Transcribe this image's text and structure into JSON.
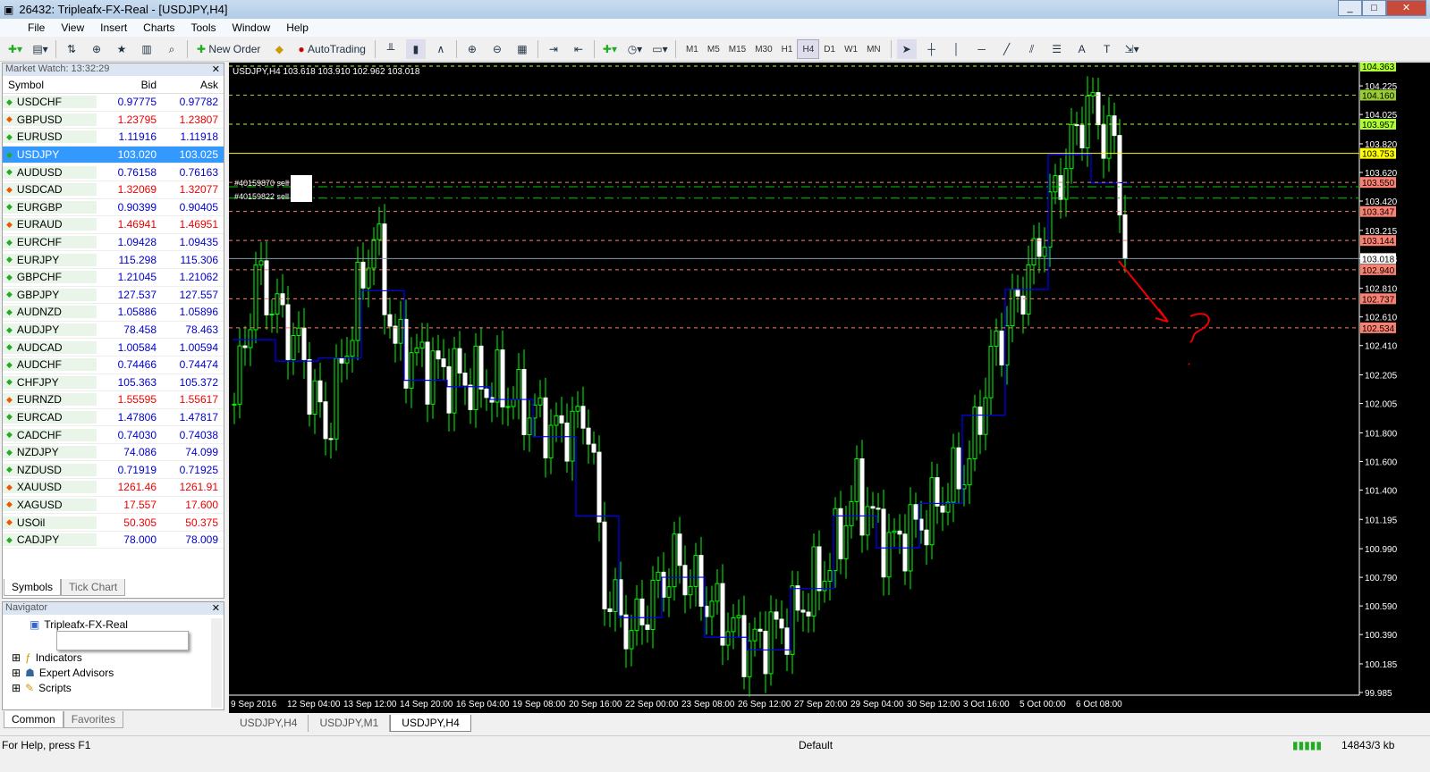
{
  "window": {
    "title": "26432: Tripleafx-FX-Real - [USDJPY,H4]"
  },
  "menu": [
    "File",
    "View",
    "Insert",
    "Charts",
    "Tools",
    "Window",
    "Help"
  ],
  "toolbar": {
    "new_order": "New Order",
    "autotrading": "AutoTrading",
    "timeframes": [
      "M1",
      "M5",
      "M15",
      "M30",
      "H1",
      "H4",
      "D1",
      "W1",
      "MN"
    ],
    "active_tf": "H4"
  },
  "market_watch": {
    "title": "Market Watch: 13:32:29",
    "headers": [
      "Symbol",
      "Bid",
      "Ask"
    ],
    "rows": [
      {
        "s": "USDCHF",
        "bid": "0.97775",
        "ask": "0.97782",
        "dir": "up"
      },
      {
        "s": "GBPUSD",
        "bid": "1.23795",
        "ask": "1.23807",
        "dir": "down"
      },
      {
        "s": "EURUSD",
        "bid": "1.11916",
        "ask": "1.11918",
        "dir": "up"
      },
      {
        "s": "USDJPY",
        "bid": "103.020",
        "ask": "103.025",
        "dir": "up",
        "selected": true
      },
      {
        "s": "AUDUSD",
        "bid": "0.76158",
        "ask": "0.76163",
        "dir": "up"
      },
      {
        "s": "USDCAD",
        "bid": "1.32069",
        "ask": "1.32077",
        "dir": "down"
      },
      {
        "s": "EURGBP",
        "bid": "0.90399",
        "ask": "0.90405",
        "dir": "up"
      },
      {
        "s": "EURAUD",
        "bid": "1.46941",
        "ask": "1.46951",
        "dir": "down"
      },
      {
        "s": "EURCHF",
        "bid": "1.09428",
        "ask": "1.09435",
        "dir": "up"
      },
      {
        "s": "EURJPY",
        "bid": "115.298",
        "ask": "115.306",
        "dir": "up"
      },
      {
        "s": "GBPCHF",
        "bid": "1.21045",
        "ask": "1.21062",
        "dir": "up"
      },
      {
        "s": "GBPJPY",
        "bid": "127.537",
        "ask": "127.557",
        "dir": "up"
      },
      {
        "s": "AUDNZD",
        "bid": "1.05886",
        "ask": "1.05896",
        "dir": "up"
      },
      {
        "s": "AUDJPY",
        "bid": "78.458",
        "ask": "78.463",
        "dir": "up"
      },
      {
        "s": "AUDCAD",
        "bid": "1.00584",
        "ask": "1.00594",
        "dir": "up"
      },
      {
        "s": "AUDCHF",
        "bid": "0.74466",
        "ask": "0.74474",
        "dir": "up"
      },
      {
        "s": "CHFJPY",
        "bid": "105.363",
        "ask": "105.372",
        "dir": "up"
      },
      {
        "s": "EURNZD",
        "bid": "1.55595",
        "ask": "1.55617",
        "dir": "down"
      },
      {
        "s": "EURCAD",
        "bid": "1.47806",
        "ask": "1.47817",
        "dir": "up"
      },
      {
        "s": "CADCHF",
        "bid": "0.74030",
        "ask": "0.74038",
        "dir": "up"
      },
      {
        "s": "NZDJPY",
        "bid": "74.086",
        "ask": "74.099",
        "dir": "up"
      },
      {
        "s": "NZDUSD",
        "bid": "0.71919",
        "ask": "0.71925",
        "dir": "up"
      },
      {
        "s": "XAUUSD",
        "bid": "1261.46",
        "ask": "1261.91",
        "dir": "down"
      },
      {
        "s": "XAGUSD",
        "bid": "17.557",
        "ask": "17.600",
        "dir": "down"
      },
      {
        "s": "USOil",
        "bid": "50.305",
        "ask": "50.375",
        "dir": "down"
      },
      {
        "s": "CADJPY",
        "bid": "78.000",
        "ask": "78.009",
        "dir": "up"
      }
    ],
    "tabs": [
      "Symbols",
      "Tick Chart"
    ]
  },
  "navigator": {
    "title": "Navigator",
    "account": "Tripleafx-FX-Real",
    "items": [
      "Indicators",
      "Expert Advisors",
      "Scripts"
    ],
    "tabs": [
      "Common",
      "Favorites"
    ]
  },
  "chart": {
    "header": "USDJPY,H4  103.618 103.910 102.962 103.018",
    "orders": [
      "#40159870 sell",
      "#40159822 sell"
    ],
    "ymin": 99.985,
    "ymax": 104.363,
    "price_ticks": [
      "104.225",
      "104.025",
      "103.820",
      "103.620",
      "103.420",
      "103.215",
      "103.018",
      "102.810",
      "102.610",
      "102.410",
      "102.205",
      "102.005",
      "101.800",
      "101.600",
      "101.400",
      "101.195",
      "100.990",
      "100.790",
      "100.590",
      "100.390",
      "100.185",
      "99.985"
    ],
    "levels": [
      {
        "p": "104.363",
        "c": "#adff2f",
        "style": "dash"
      },
      {
        "p": "104.160",
        "c": "#9acd32",
        "style": "dash"
      },
      {
        "p": "103.957",
        "c": "#adff2f",
        "style": "dash"
      },
      {
        "p": "103.753",
        "c": "#ffff00",
        "style": "solid"
      },
      {
        "p": "103.550",
        "c": "#fa8072",
        "style": "dash"
      },
      {
        "p": "103.347",
        "c": "#fa8072",
        "style": "dash"
      },
      {
        "p": "103.144",
        "c": "#fa8072",
        "style": "dash"
      },
      {
        "p": "103.018",
        "c": "#ffffff",
        "style": "bid"
      },
      {
        "p": "102.940",
        "c": "#fa8072",
        "style": "dash"
      },
      {
        "p": "102.737",
        "c": "#fa8072",
        "style": "dash"
      },
      {
        "p": "102.534",
        "c": "#fa8072",
        "style": "dash"
      }
    ],
    "path": [
      [
        0,
        102.0
      ],
      [
        4,
        102.9
      ],
      [
        12,
        102.4
      ],
      [
        17,
        101.8
      ],
      [
        26,
        103.2
      ],
      [
        30,
        102.4
      ],
      [
        40,
        102.2
      ],
      [
        50,
        102.1
      ],
      [
        60,
        101.8
      ],
      [
        66,
        101.9
      ],
      [
        69,
        100.7
      ],
      [
        74,
        100.4
      ],
      [
        82,
        100.9
      ],
      [
        91,
        100.5
      ],
      [
        96,
        100.3
      ],
      [
        104,
        100.5
      ],
      [
        111,
        100.9
      ],
      [
        116,
        101.4
      ],
      [
        122,
        101.0
      ],
      [
        129,
        101.2
      ],
      [
        137,
        101.6
      ],
      [
        141,
        102.3
      ],
      [
        149,
        103.0
      ],
      [
        154,
        103.6
      ],
      [
        159,
        104.1
      ],
      [
        164,
        103.8
      ],
      [
        166,
        103.018
      ]
    ],
    "date_labels": [
      "9 Sep 2016",
      "12 Sep 04:00",
      "13 Sep 12:00",
      "14 Sep 20:00",
      "16 Sep 04:00",
      "19 Sep 08:00",
      "20 Sep 16:00",
      "22 Sep 00:00",
      "23 Sep 08:00",
      "26 Sep 12:00",
      "27 Sep 20:00",
      "29 Sep 04:00",
      "30 Sep 12:00",
      "3 Oct 16:00",
      "5 Oct 00:00",
      "6 Oct 08:00"
    ],
    "tabs": [
      "USDJPY,H4",
      "USDJPY,M1",
      "USDJPY,H4"
    ]
  },
  "status": {
    "help": "For Help, press F1",
    "profile": "Default",
    "traffic": "14843/3 kb"
  }
}
